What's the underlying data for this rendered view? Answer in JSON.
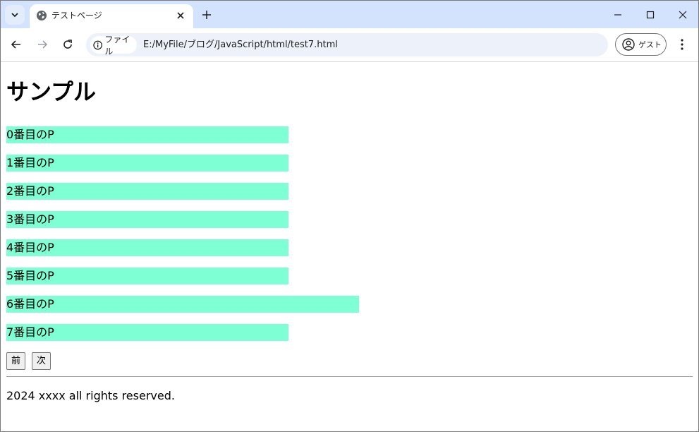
{
  "browser": {
    "tab_title": "テストページ",
    "url_chip_label": "ファイル",
    "url": "E:/MyFile/ブログ/JavaScript/html/test7.html",
    "profile_label": "ゲスト",
    "icons": [
      "tab-search-icon",
      "globe-icon",
      "close-icon",
      "plus-icon",
      "minimize-icon",
      "maximize-icon",
      "window-close-icon",
      "back-icon",
      "forward-icon",
      "reload-icon",
      "info-icon",
      "profile-icon",
      "more-icon"
    ]
  },
  "page": {
    "title": "サンプル",
    "paragraphs": [
      {
        "label": "0番目のP"
      },
      {
        "label": "1番目のP"
      },
      {
        "label": "2番目のP"
      },
      {
        "label": "3番目のP"
      },
      {
        "label": "4番目のP"
      },
      {
        "label": "5番目のP"
      },
      {
        "label": "6番目のP"
      },
      {
        "label": "7番目のP"
      }
    ],
    "prev_button": "前",
    "next_button": "次",
    "footer": "2024 xxxx all rights reserved.",
    "highlight_color": "#7fffd4"
  }
}
